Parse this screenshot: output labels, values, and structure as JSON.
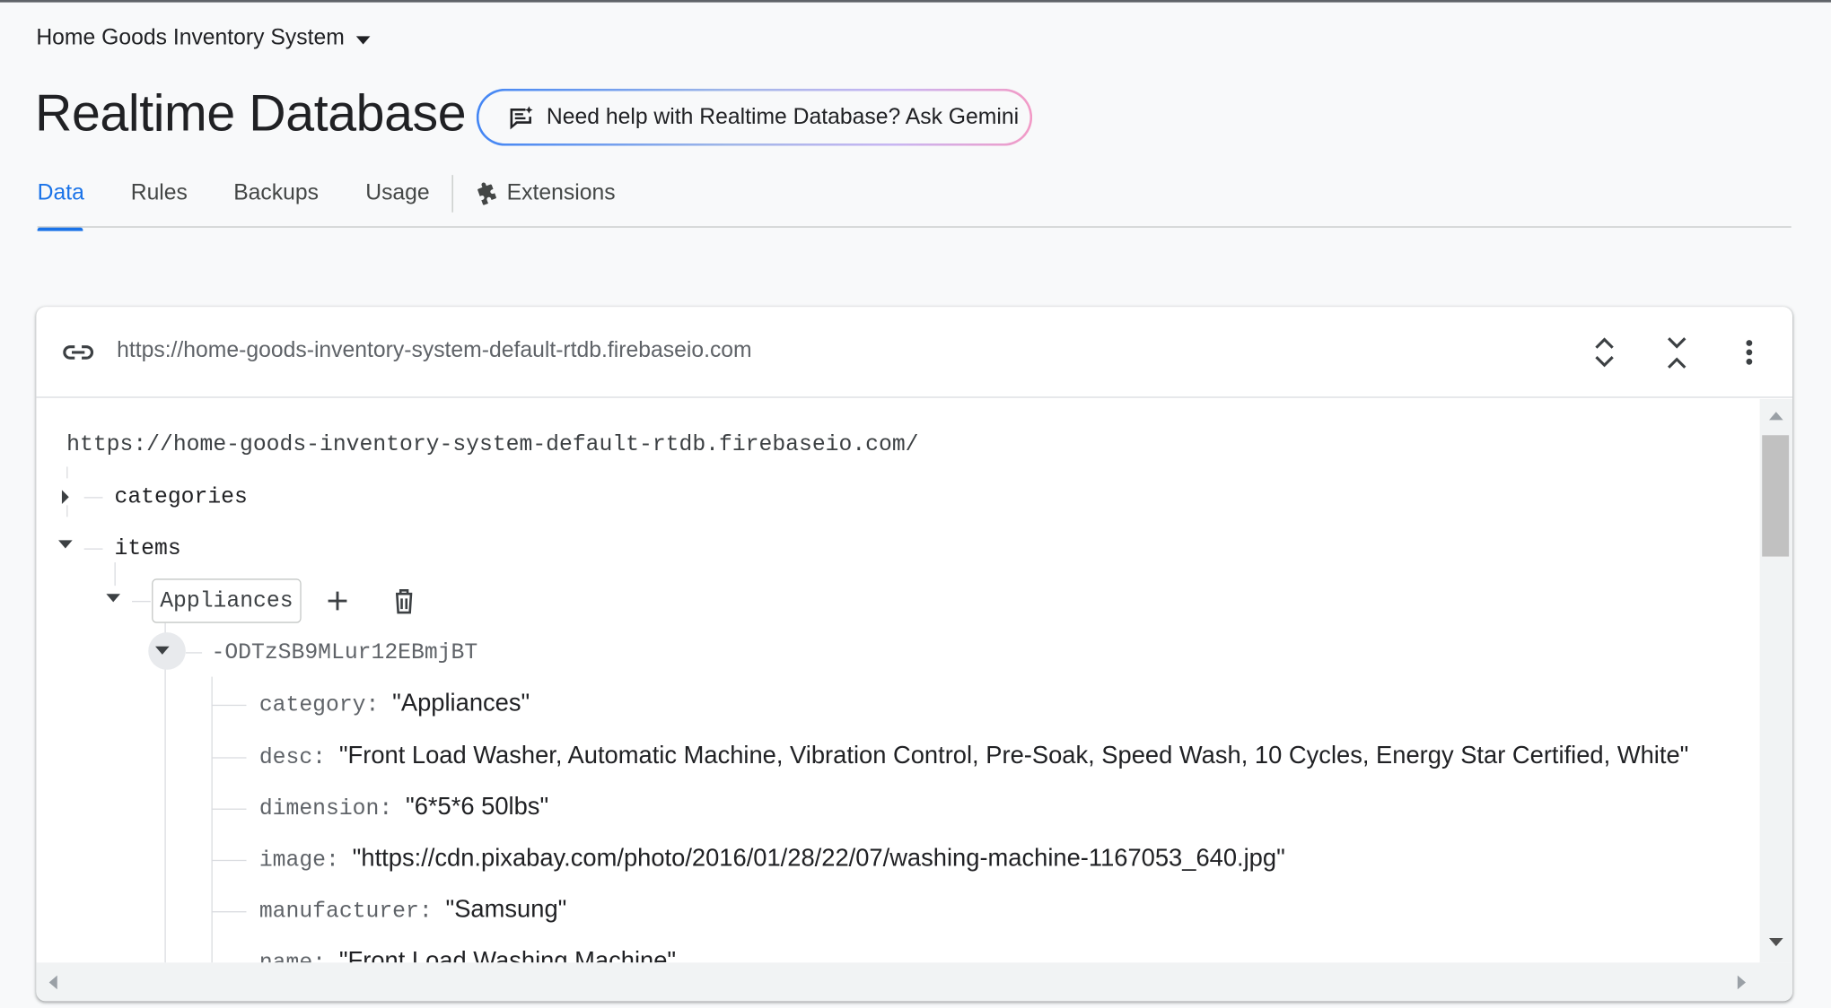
{
  "header": {
    "project_name": "Home Goods Inventory System",
    "page_title": "Realtime Database",
    "gemini_button": "Need help with Realtime Database? Ask Gemini"
  },
  "tabs": [
    {
      "label": "Data",
      "active": true
    },
    {
      "label": "Rules",
      "active": false
    },
    {
      "label": "Backups",
      "active": false
    },
    {
      "label": "Usage",
      "active": false
    },
    {
      "label": "Extensions",
      "active": false
    }
  ],
  "database": {
    "url": "https://home-goods-inventory-system-default-rtdb.firebaseio.com",
    "root_url": "https://home-goods-inventory-system-default-rtdb.firebaseio.com/",
    "nodes": {
      "categories": "categories",
      "items": "items",
      "appliances": "Appliances",
      "record_id": "-ODTzSB9MLur12EBmjBT"
    },
    "fields": [
      {
        "key": "category",
        "value": "\"Appliances\""
      },
      {
        "key": "desc",
        "value": "\"Front Load Washer, Automatic Machine, Vibration Control, Pre-Soak, Speed Wash, 10 Cycles, Energy Star Certified, White\""
      },
      {
        "key": "dimension",
        "value": "\"6*5*6 50lbs\""
      },
      {
        "key": "image",
        "value": "\"https://cdn.pixabay.com/photo/2016/01/28/22/07/washing-machine-1167053_640.jpg\""
      },
      {
        "key": "manufacturer",
        "value": "\"Samsung\""
      },
      {
        "key": "name",
        "value": "\"Front Load Washing Machine\""
      }
    ]
  },
  "colors": {
    "accent": "#1a73e8",
    "text": "#202124",
    "muted": "#5f6368",
    "divider": "#dadce0"
  },
  "icons": {
    "project_dropdown": "caret-down-icon",
    "gemini": "chat-spark-icon",
    "extensions": "puzzle-icon",
    "link": "link-icon",
    "expand_all": "expand-all-icon",
    "collapse_all": "collapse-all-icon",
    "more": "more-vert-icon",
    "add": "plus-icon",
    "delete": "trash-icon"
  }
}
